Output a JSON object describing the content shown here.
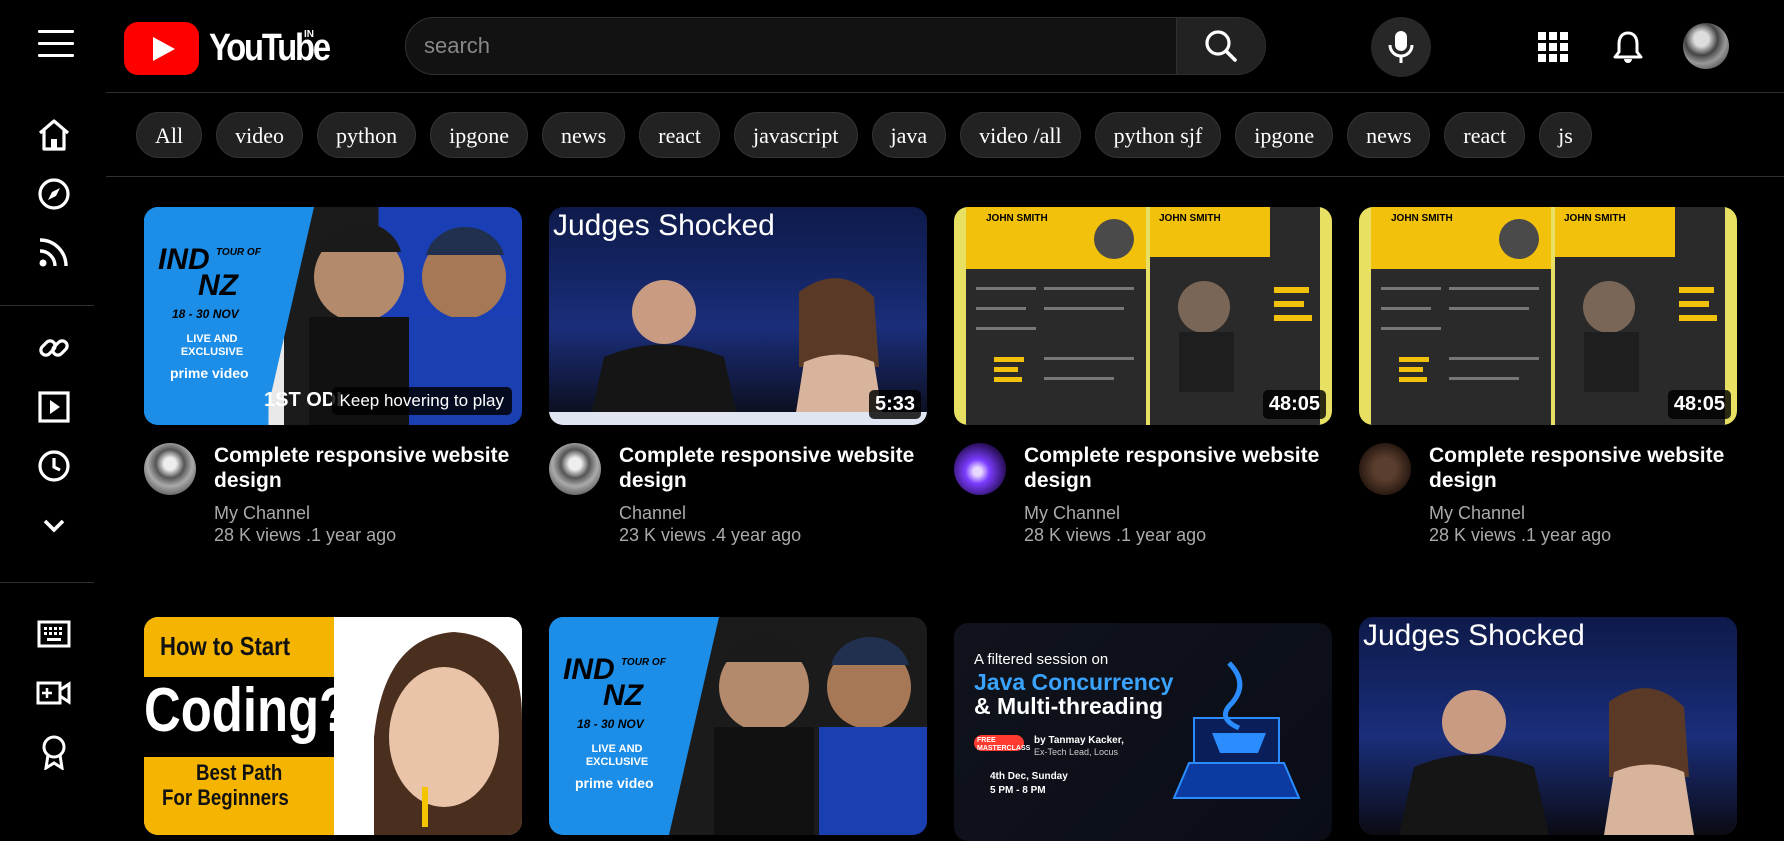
{
  "header": {
    "logo_text": "YouTube",
    "country_code": "IN",
    "search_placeholder": "search"
  },
  "colors": {
    "brand": "#ff0000",
    "background": "#000000",
    "chip_bg": "#222222"
  },
  "icons": {
    "top": [
      "hamburger-menu-icon",
      "search-icon",
      "mic-icon",
      "apps-grid-icon",
      "bell-icon"
    ],
    "sidebar": [
      "home-icon",
      "explore-compass-icon",
      "subscriptions-feed-icon",
      "link-icon",
      "play-square-icon",
      "history-clock-icon",
      "chevron-down-icon",
      "keyboard-icon",
      "video-camera-icon",
      "award-icon"
    ]
  },
  "chips": [
    "All",
    "video",
    "python",
    "ipgone",
    "news",
    "react",
    "javascript",
    "java",
    "video /all",
    "python sjf",
    "ipgone",
    "news",
    "react",
    "js"
  ],
  "videos": [
    {
      "title": "Complete responsive website design",
      "channel": "My Channel",
      "stats": "28 K views .1 year ago",
      "duration": "",
      "hover_text": "Keep hovering to play",
      "thumb_text": {
        "brand": "IND",
        "tour": "TOUR OF",
        "nz": "NZ",
        "dates": "18 - 30 NOV",
        "live": "LIVE AND EXCLUSIVE",
        "prime": "prime video",
        "odi": "1ST ODI"
      }
    },
    {
      "title": "Complete responsive website design",
      "channel": "Channel",
      "stats": "23 K views .4 year ago",
      "duration": "5:33",
      "hover_text": "",
      "thumb_text": {
        "headline": "Judges Shocked"
      }
    },
    {
      "title": "Complete responsive website design",
      "channel": "My Channel",
      "stats": "28 K views .1 year ago",
      "duration": "48:05",
      "hover_text": "",
      "thumb_text": {
        "name": "JOHN SMITH"
      }
    },
    {
      "title": "Complete responsive website design",
      "channel": "My Channel",
      "stats": "28 K views .1 year ago",
      "duration": "48:05",
      "hover_text": "",
      "thumb_text": {
        "name": "JOHN SMITH"
      }
    }
  ],
  "row2": [
    {
      "thumb_text": {
        "line1": "How to Start",
        "line2": "Coding?",
        "line3": "Best Path",
        "line4": "For Beginners"
      }
    },
    {
      "thumb_text": {
        "brand": "IND",
        "tour": "TOUR OF",
        "nz": "NZ",
        "dates": "18 - 30 NOV",
        "live": "LIVE AND EXCLUSIVE",
        "prime": "prime video"
      }
    },
    {
      "thumb_text": {
        "intro": "A filtered session on",
        "line1": "Java Concurrency",
        "line2": "& Multi-threading",
        "badge": "FREE MASTERCLASS",
        "by": "by Tanmay Kacker,",
        "role": "Ex-Tech Lead, Locus",
        "date": "4th Dec, Sunday",
        "time": "5 PM - 8 PM"
      }
    },
    {
      "thumb_text": {
        "headline": "Judges Shocked"
      }
    }
  ]
}
